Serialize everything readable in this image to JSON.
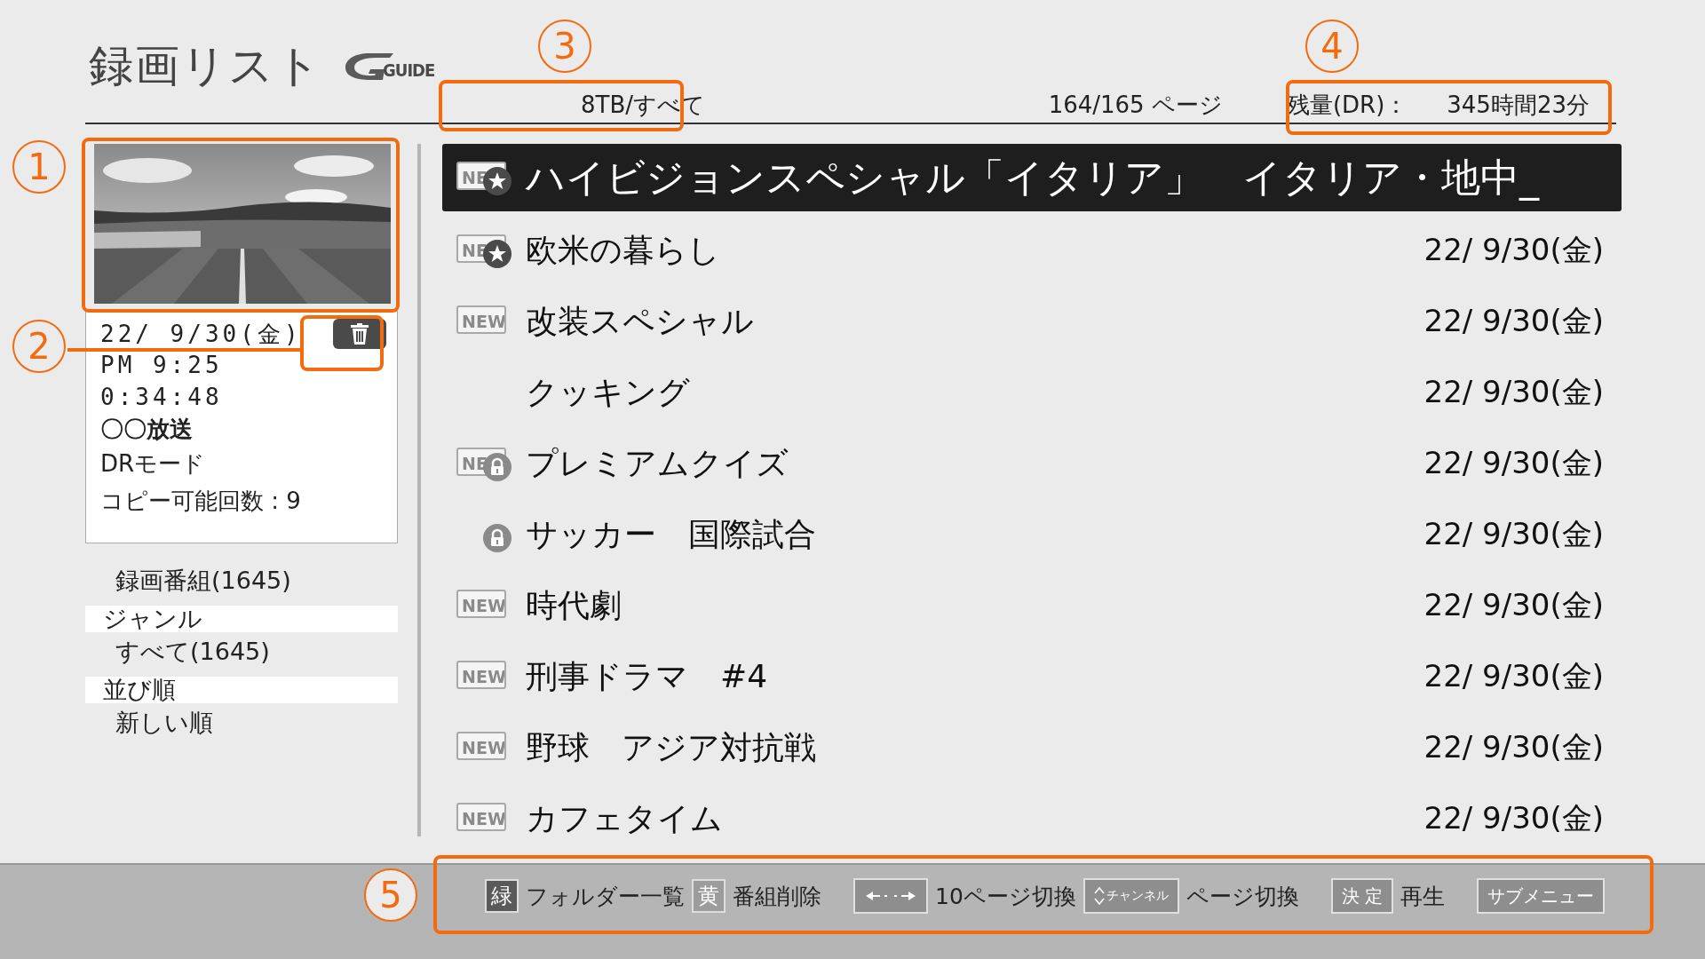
{
  "header": {
    "title": "録画リスト",
    "logo": "GUIDE",
    "drive": "8TB/すべて",
    "page": "164/165 ページ",
    "remaining_label": "残量(DR)：",
    "remaining_value": "345時間23分"
  },
  "info": {
    "lines": [
      {
        "text": "22/ 9/30(金)",
        "kind": "mono"
      },
      {
        "text": "PM 9:25",
        "kind": "mono"
      },
      {
        "text": "0:34:48",
        "kind": "mono"
      },
      {
        "text": "〇〇放送",
        "kind": "bold"
      },
      {
        "text": "DRモード",
        "kind": "plain"
      },
      {
        "text": "コピー可能回数 : 9",
        "kind": "plain"
      }
    ]
  },
  "sidebar": {
    "items": [
      {
        "text": "録画番組(1645)",
        "kind": "item"
      },
      {
        "text": "ジャンル",
        "kind": "heading"
      },
      {
        "text": "すべて(1645)",
        "kind": "item"
      },
      {
        "text": "並び順",
        "kind": "heading"
      },
      {
        "text": "新しい順",
        "kind": "item"
      }
    ]
  },
  "recordings": [
    {
      "title": "ハイビジョンスペシャル「イタリア」　イタリア・地中_",
      "badge": "NE",
      "favorite": true,
      "locked": false,
      "selected": true
    },
    {
      "title": "欧米の暮らし",
      "date": "22/ 9/30(金)",
      "badge": "NE",
      "favorite": true,
      "locked": false,
      "selected": false
    },
    {
      "title": "改装スペシャル",
      "date": "22/ 9/30(金)",
      "badge": "NEW",
      "favorite": false,
      "locked": false,
      "selected": false
    },
    {
      "title": "クッキング",
      "date": "22/ 9/30(金)",
      "favorite": false,
      "locked": false,
      "selected": false
    },
    {
      "title": "プレミアムクイズ",
      "date": "22/ 9/30(金)",
      "badge": "NE",
      "favorite": false,
      "locked": true,
      "selected": false
    },
    {
      "title": "サッカー　国際試合",
      "date": "22/ 9/30(金)",
      "favorite": false,
      "locked": true,
      "selected": false
    },
    {
      "title": "時代劇",
      "date": "22/ 9/30(金)",
      "badge": "NEW",
      "favorite": false,
      "locked": false,
      "selected": false
    },
    {
      "title": "刑事ドラマ　#4",
      "date": "22/ 9/30(金)",
      "badge": "NEW",
      "favorite": false,
      "locked": false,
      "selected": false
    },
    {
      "title": "野球　アジア対抗戦",
      "date": "22/ 9/30(金)",
      "badge": "NEW",
      "favorite": false,
      "locked": false,
      "selected": false
    },
    {
      "title": "カフェタイム",
      "date": "22/ 9/30(金)",
      "badge": "NEW",
      "favorite": false,
      "locked": false,
      "selected": false
    }
  ],
  "footer": {
    "groups": [
      [
        {
          "kind": "color",
          "label": "緑",
          "color": "#5a5a5a"
        },
        {
          "kind": "text",
          "label": "フォルダー一覧"
        },
        {
          "kind": "color",
          "label": "黄",
          "color": "#9c9c9c"
        },
        {
          "kind": "text",
          "label": "番組削除"
        }
      ],
      [
        {
          "kind": "arrows"
        },
        {
          "kind": "text",
          "label": "10ページ切換"
        },
        {
          "kind": "channel",
          "label": "チャンネル"
        },
        {
          "kind": "text",
          "label": "ページ切換"
        }
      ],
      [
        {
          "kind": "button",
          "label": "決 定"
        },
        {
          "kind": "text",
          "label": "再生"
        }
      ],
      [
        {
          "kind": "button",
          "label": "サブメニュー"
        }
      ]
    ]
  },
  "callouts": [
    {
      "number": "1"
    },
    {
      "number": "2"
    },
    {
      "number": "3"
    },
    {
      "number": "4"
    },
    {
      "number": "5"
    }
  ]
}
